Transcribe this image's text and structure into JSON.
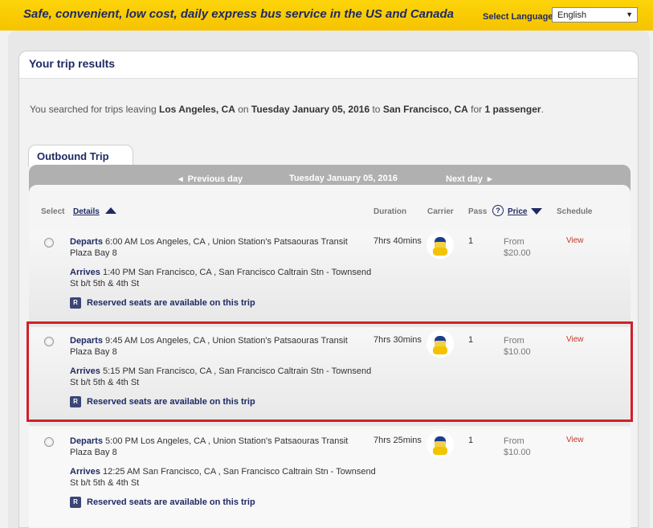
{
  "topbar": {
    "tagline": "Safe, convenient, low cost, daily express bus service in the US and Canada",
    "language_label": "Select Language",
    "language_value": "English"
  },
  "results": {
    "title": "Your trip results",
    "summary": {
      "prefix": "You searched for trips leaving ",
      "origin": "Los Angeles, CA",
      "on": " on ",
      "date": "Tuesday January 05, 2016",
      "to": " to ",
      "destination": "San Francisco, CA",
      "for": " for ",
      "passengers": "1 passenger",
      "suffix": "."
    },
    "tab_label": "Outbound Trip",
    "nav": {
      "prev": "Previous day",
      "current": "Tuesday January 05, 2016",
      "next": "Next day"
    },
    "headers": {
      "select": "Select",
      "details": "Details",
      "duration": "Duration",
      "carrier": "Carrier",
      "pass": "Pass",
      "price": "Price",
      "schedule": "Schedule"
    },
    "trips": [
      {
        "departs_label": "Departs",
        "departs": "6:00 AM Los Angeles, CA , Union Station's Patsaouras Transit Plaza Bay 8",
        "arrives_label": "Arrives",
        "arrives": "1:40 PM San Francisco, CA , San Francisco Caltrain Stn - Townsend St b/t 5th & 4th St",
        "reserved": "Reserved seats are available on this trip",
        "duration": "7hrs 40mins",
        "pass": "1",
        "price_from": "From",
        "price": "$20.00",
        "view": "View"
      },
      {
        "departs_label": "Departs",
        "departs": "9:45 AM Los Angeles, CA , Union Station's Patsaouras Transit Plaza Bay 8",
        "arrives_label": "Arrives",
        "arrives": "5:15 PM San Francisco, CA , San Francisco Caltrain Stn - Townsend St b/t 5th & 4th St",
        "reserved": "Reserved seats are available on this trip",
        "duration": "7hrs 30mins",
        "pass": "1",
        "price_from": "From",
        "price": "$10.00",
        "view": "View"
      },
      {
        "departs_label": "Departs",
        "departs": "5:00 PM Los Angeles, CA , Union Station's Patsaouras Transit Plaza Bay 8",
        "arrives_label": "Arrives",
        "arrives": "12:25 AM San Francisco, CA , San Francisco Caltrain Stn - Townsend St b/t 5th & 4th St",
        "reserved": "Reserved seats are available on this trip",
        "duration": "7hrs 25mins",
        "pass": "1",
        "price_from": "From",
        "price": "$10.00",
        "view": "View"
      }
    ]
  },
  "icons": {
    "help": "?",
    "reserved_badge": "R",
    "prev_arrow": "◂",
    "next_arrow": "▸",
    "dropdown_arrow": "▼"
  },
  "colors": {
    "brand_yellow": "#f6c300",
    "brand_navy": "#1f2a63",
    "view_link": "#c0392b",
    "highlight": "#d0202a"
  }
}
